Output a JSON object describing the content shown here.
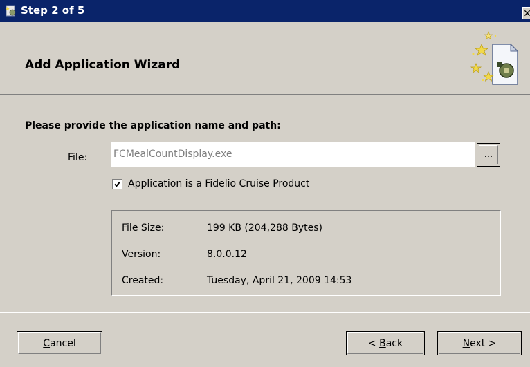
{
  "window": {
    "title": "Step 2 of 5",
    "close_label": "✕"
  },
  "header": {
    "title": "Add Application Wizard"
  },
  "form": {
    "prompt": "Please provide the application name and path:",
    "file_label": "File:",
    "file_value": "FCMealCountDisplay.exe",
    "browse_label": "...",
    "checkbox_checked": true,
    "checkbox_label": "Application is a Fidelio Cruise Product"
  },
  "info": {
    "rows": [
      {
        "label": "File Size:",
        "value": "199 KB (204,288 Bytes)"
      },
      {
        "label": "Version:",
        "value": "8.0.0.12"
      },
      {
        "label": "Created:",
        "value": "Tuesday, April 21, 2009 14:53"
      }
    ]
  },
  "buttons": {
    "cancel": {
      "mnemonic": "C",
      "rest": "ancel"
    },
    "back": {
      "prefix": "< ",
      "mnemonic": "B",
      "rest": "ack"
    },
    "next": {
      "mnemonic": "N",
      "rest": "ext >"
    }
  },
  "colors": {
    "titlebar": "#0a246a",
    "dialog": "#d4d0c8"
  }
}
